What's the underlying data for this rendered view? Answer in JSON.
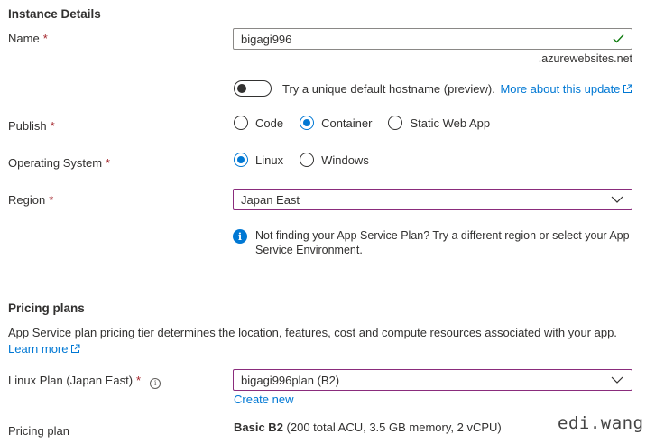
{
  "instance": {
    "title": "Instance Details",
    "name_label": "Name",
    "required_marker": "*",
    "name_value": "bigagi996",
    "name_suffix": ".azurewebsites.net",
    "hostname_toggle_label": "Try a unique default hostname (preview).",
    "hostname_link": "More about this update",
    "publish_label": "Publish",
    "publish_options": [
      "Code",
      "Container",
      "Static Web App"
    ],
    "publish_selected": "Container",
    "os_label": "Operating System",
    "os_options": [
      "Linux",
      "Windows"
    ],
    "os_selected": "Linux",
    "region_label": "Region",
    "region_value": "Japan East",
    "region_info_line1": "Not finding your App Service Plan? Try a different region or select your App",
    "region_info_line2": "Service Environment."
  },
  "pricing": {
    "title": "Pricing plans",
    "description": "App Service plan pricing tier determines the location, features, cost and compute resources associated with your app.",
    "learn_more": "Learn more",
    "plan_label": "Linux Plan (Japan East)",
    "plan_value": "bigagi996plan (B2)",
    "create_new": "Create new",
    "pricing_plan_label": "Pricing plan",
    "pricing_plan_name": "Basic B2",
    "pricing_plan_detail": "(200 total ACU, 3.5 GB memory, 2 vCPU)"
  },
  "watermark": "edi.wang",
  "colors": {
    "accent": "#0078d4",
    "required": "#a4262c",
    "focus_border": "#8a2c7c",
    "valid": "#107c10"
  },
  "icons": {
    "valid": "checkmark-icon",
    "dropdown": "chevron-down-icon",
    "external": "external-link-icon",
    "info": "info-icon"
  }
}
